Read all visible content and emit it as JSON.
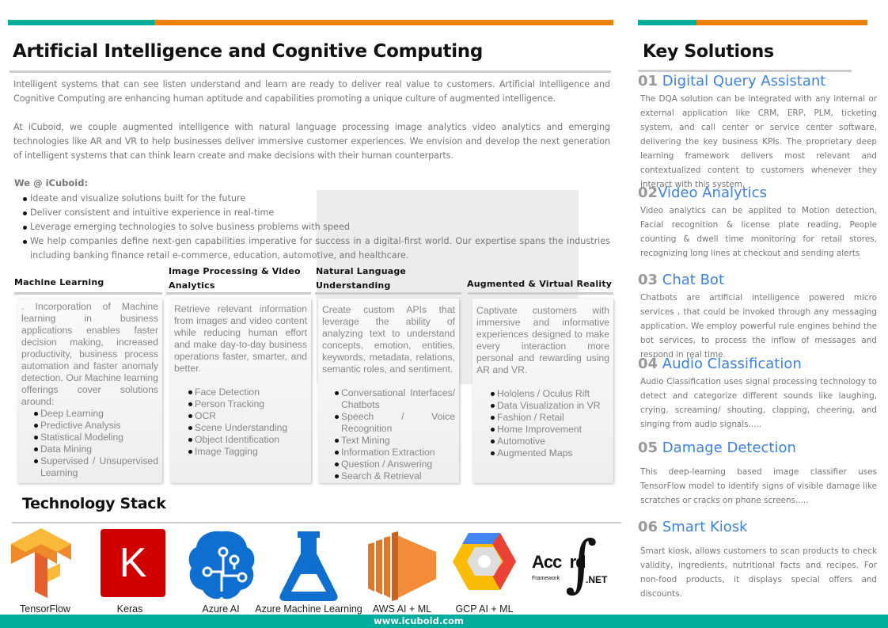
{
  "colors": {
    "teal": "#00ad9c",
    "orange": "#ee8200",
    "blue": "#3b82e8"
  },
  "main": {
    "title": "Artificial Intelligence and Cognitive Computing",
    "para1": "Intelligent systems that can see listen understand and learn are ready to deliver real value to customers. Artificial Intelligence and Cognitive Computing are enhancing human aptitude and capabilities promoting a unique culture of augmented intelligence.",
    "para2": "At iCuboid, we couple augmented intelligence with natural language processing image analytics video analytics and emerging technologies like AR and VR to help businesses deliver immersive customer experiences. We envision and develop the next generation of intelligent systems that can think learn create and make decisions with their human counterparts.",
    "we_heading": "We @ iCuboid:",
    "we_items": [
      "Ideate and visualize solutions built for the future",
      "Deliver consistent and intuitive experience in real-time",
      "Leverage emerging technologies to solve business problems with speed",
      "We help companies define next-gen capabilities imperative for success in a digital-first world. Our expertise spans the industries including banking finance retail e-commerce, education, automotive, and healthcare."
    ]
  },
  "cards": [
    {
      "title": "Machine Learning",
      "text": ". Incorporation of Machine learning in business applications enables faster decision making, increased productivity, business process automation and faster anomaly detection. Our Machine learning offerings cover solutions around:",
      "items": [
        "Deep Learning",
        "Predictive Analysis",
        "Statistical Modeling",
        "Data Mining",
        "Supervised / Unsupervised Learning"
      ]
    },
    {
      "title": "Image Processing & Video Analytics",
      "text": "Retrieve relevant information from images and video content while reducing human effort and make day-to-day business operations faster, smarter, and better.",
      "items": [
        "Face Detection",
        "Person Tracking",
        "OCR",
        "Scene Understanding",
        "Object Identification",
        "Image Tagging"
      ]
    },
    {
      "title": "Natural Language Understanding",
      "text": "Create custom APIs that leverage the ability of analyzing text to understand concepts, emotion, entities, keywords, metadata, relations, semantic roles, and sentiment.",
      "items": [
        "Conversational Interfaces/ Chatbots",
        "Speech / Voice Recognition",
        "Text Mining",
        "Information Extraction",
        "Question / Answering",
        "Search & Retrieval"
      ]
    },
    {
      "title": "Augmented & Virtual Reality",
      "text": "Captivate customers with immersive and informative experiences designed to make every interaction more personal and rewarding using AR and VR.",
      "items": [
        "Hololens / Oculus Rift",
        "Data Visualization in VR",
        "Fashion / Retail",
        "Home Improvement",
        "Automotive",
        "Augmented Maps"
      ]
    }
  ],
  "tech": {
    "title": "Technology Stack",
    "labels": [
      "TensorFlow",
      "Keras",
      "Azure AI",
      "Azure Machine Learning",
      "AWS AI + ML",
      "GCP AI + ML"
    ],
    "accord_logo": "Accord Framework .NET",
    "keras_logo": "K"
  },
  "solutions": {
    "title": "Key Solutions",
    "items": [
      {
        "num": "01",
        "title": "Digital Query Assistant",
        "text": "The DQA solution can be integrated with any internal or external application like CRM, ERP, PLM, ticketing system, and call center or service center software, delivering the key business KPIs. The proprietary deep learning framework delivers most relevant and contextualized content to customers whenever they interact with this system."
      },
      {
        "num": "02",
        "title": "Video Analytics",
        "text": "Video analytics can be applited to Motion detection, Facial recognition & license plate reading, People counting & dwell time monitoring for retail stores, recognizing long lines at checkout and sending alerts"
      },
      {
        "num": "03",
        "title": "Chat Bot",
        "text": "Chatbots are artificial intelligence powered micro services , that could be invoked through any messaging application. We employ powerful rule engines behind the bot services, to process the inflow of messages and respond in real time."
      },
      {
        "num": "04",
        "title": "Audio Classification",
        "text": "Audio Classification uses signal processing technology to detect and categorize different sounds like laughing, crying, screaming/ shouting, clapping, cheering, and singing from audio signals....."
      },
      {
        "num": "05",
        "title": "Damage Detection",
        "text": "This deep-learning based image classifier uses TensorFlow model to identify signs of visible damage like scratches or cracks on phone screens....."
      },
      {
        "num": "06",
        "title": "Smart Kiosk",
        "text": "Smart kiosk, allows customers to scan products to check validity, ingredients, nutritional facts and recipes. For non-food products, it displays special offers and discounts."
      }
    ]
  },
  "footer": {
    "url": "www.icuboid.com"
  }
}
